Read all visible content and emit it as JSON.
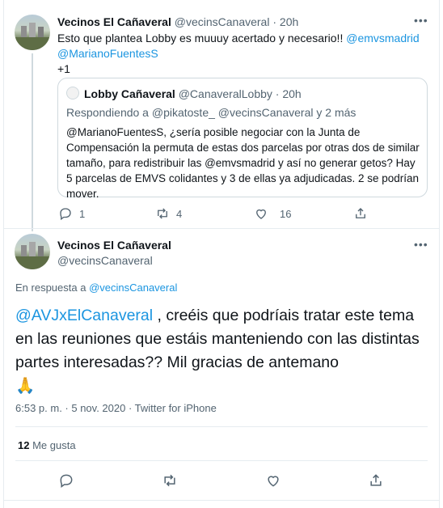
{
  "tweet1": {
    "name": "Vecinos El Cañaveral",
    "handle": "@vecinsCanaveral",
    "sep": "·",
    "time": "20h",
    "text": "Esto que plantea Lobby es muuuy acertado y necesario!! ",
    "mention1": "@emvsmadrid",
    "mention2": "@MarianoFuentesS",
    "plus": "+1",
    "quoted": {
      "name": "Lobby Cañaveral",
      "handle": "@CanaveralLobby",
      "sep": "·",
      "time": "20h",
      "replying": "Respondiendo a @pikatoste_ @vecinsCanaveral y 2 más",
      "text": "@MarianoFuentesS, ¿sería posible negociar con la Junta de Compensación la permuta de estas dos parcelas por otras dos de similar tamaño, para redistribuir las @emvsmadrid y así no generar getos? Hay 5 parcelas de EMVS colidantes y 3 de ellas ya adjudicadas. 2 se podrían mover."
    },
    "replies": "1",
    "retweets": "4",
    "likes": "16",
    "more_icon": "more-dots-icon"
  },
  "tweet2": {
    "name": "Vecinos El Cañaveral",
    "handle": "@vecinsCanaveral",
    "reply_prefix": "En respuesta a ",
    "reply_to": "@vecinsCanaveral",
    "mention": "@AVJxElCanaveral",
    "text": " , creéis que podríais tratar este tema en las reuniones que estáis manteniendo con las distintas partes interesadas?? Mil gracias de antemano",
    "emoji": "🙏",
    "timestamp": "6:53 p. m. · 5 nov. 2020 · ",
    "source": "Twitter for iPhone",
    "likes_count": "12",
    "likes_label": " Me gusta"
  },
  "colors": {
    "link": "#1b95e0",
    "muted": "#536471",
    "border": "#e6ecf0"
  }
}
